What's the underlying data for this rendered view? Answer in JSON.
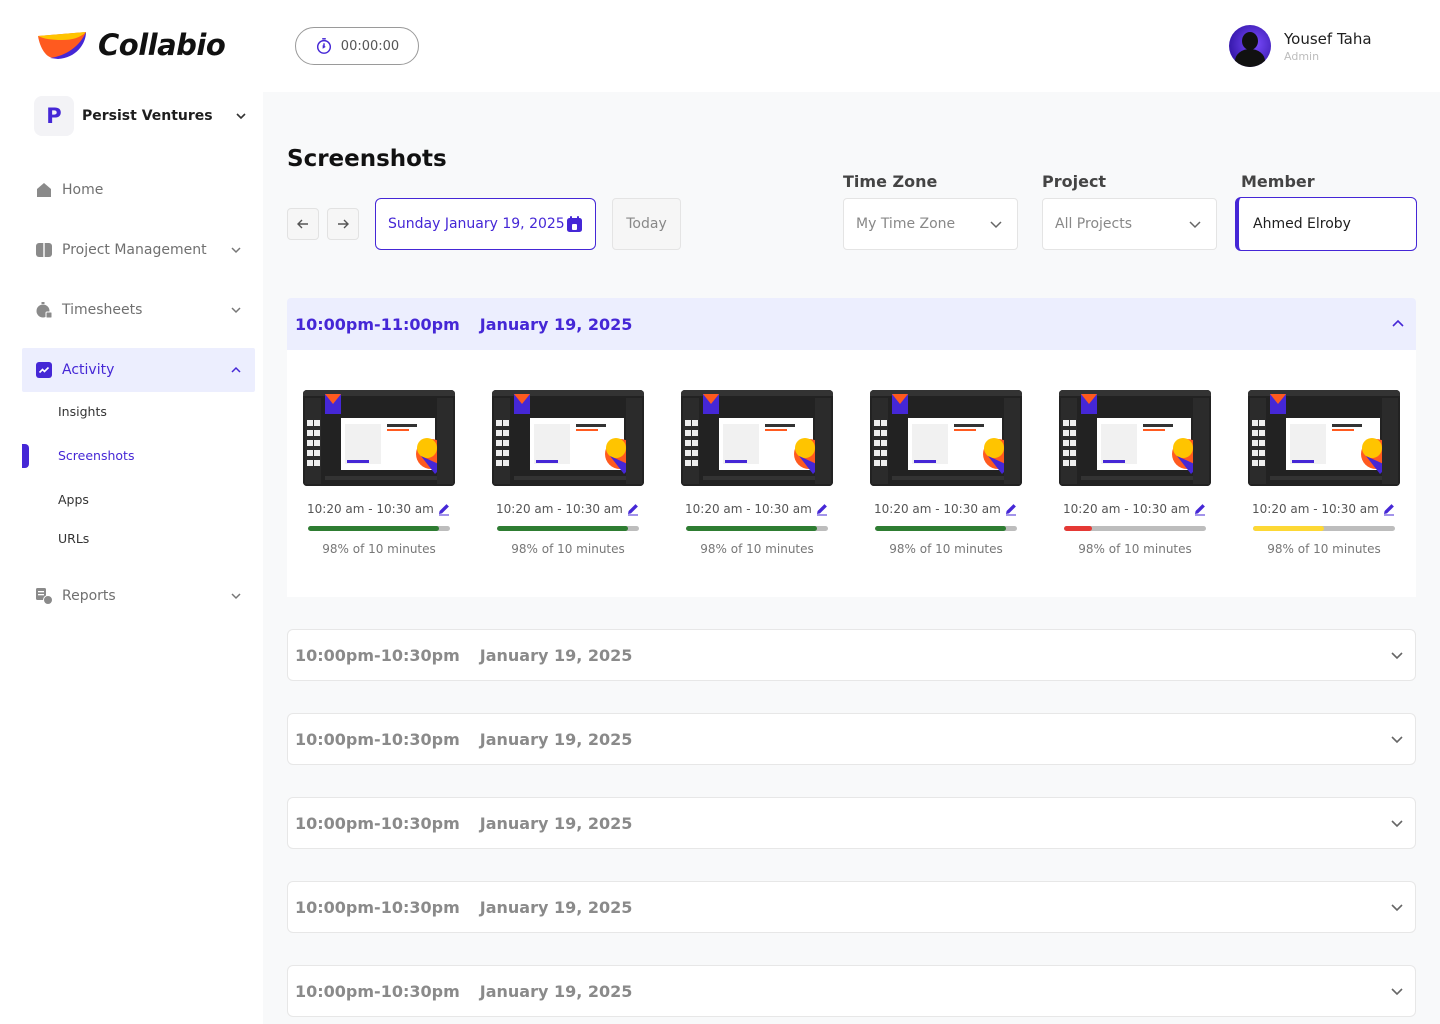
{
  "brand": {
    "name": "Collabio"
  },
  "timer": {
    "value": "00:00:00"
  },
  "user": {
    "name": "Yousef Taha",
    "role": "Admin"
  },
  "org": {
    "initial": "P",
    "name": "Persist Ventures"
  },
  "nav": {
    "home": "Home",
    "project_management": "Project Management",
    "timesheets": "Timesheets",
    "activity": "Activity",
    "reports": "Reports",
    "activity_sub": {
      "insights": "Insights",
      "screenshots": "Screenshots",
      "apps": "Apps",
      "urls": "URLs"
    }
  },
  "page": {
    "title": "Screenshots",
    "date": "Sunday January 19, 2025",
    "today": "Today"
  },
  "filters": {
    "timezone": {
      "label": "Time Zone",
      "value": "My Time Zone"
    },
    "project": {
      "label": "Project",
      "value": "All Projects"
    },
    "member": {
      "label": "Member",
      "value": "Ahmed Elroby"
    }
  },
  "open_section": {
    "time": "10:00pm-11:00pm",
    "date": "January 19, 2025"
  },
  "screenshots": [
    {
      "range": "10:20 am - 10:30 am",
      "percent_label": "98% of 10 minutes",
      "activity": 0.92,
      "color": "#2e7d32"
    },
    {
      "range": "10:20 am - 10:30 am",
      "percent_label": "98% of 10 minutes",
      "activity": 0.92,
      "color": "#2e7d32"
    },
    {
      "range": "10:20 am - 10:30 am",
      "percent_label": "98% of 10 minutes",
      "activity": 0.92,
      "color": "#2e7d32"
    },
    {
      "range": "10:20 am - 10:30 am",
      "percent_label": "98% of 10 minutes",
      "activity": 0.92,
      "color": "#2e7d32"
    },
    {
      "range": "10:20 am - 10:30 am",
      "percent_label": "98% of 10 minutes",
      "activity": 0.2,
      "color": "#e53935"
    },
    {
      "range": "10:20 am - 10:30 am",
      "percent_label": "98% of 10 minutes",
      "activity": 0.5,
      "color": "#fdd835"
    }
  ],
  "collapsed_sections": [
    {
      "time": "10:00pm-10:30pm",
      "date": "January 19, 2025"
    },
    {
      "time": "10:00pm-10:30pm",
      "date": "January 19, 2025"
    },
    {
      "time": "10:00pm-10:30pm",
      "date": "January 19, 2025"
    },
    {
      "time": "10:00pm-10:30pm",
      "date": "January 19, 2025"
    },
    {
      "time": "10:00pm-10:30pm",
      "date": "January 19, 2025"
    }
  ],
  "colors": {
    "accent": "#4527d6",
    "accent_light": "#eceefe"
  }
}
